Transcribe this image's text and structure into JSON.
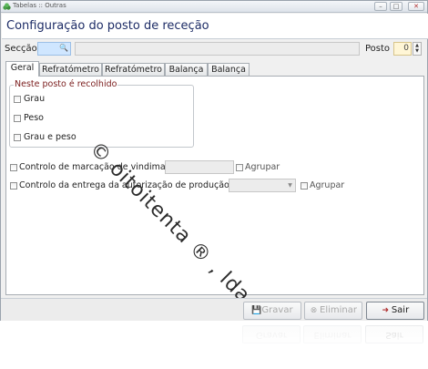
{
  "window": {
    "title": "Tabelas :: Outras",
    "controls": {
      "minimize": "–",
      "maximize": "□",
      "close": "✕"
    }
  },
  "header": {
    "page_title": "Configuração do posto de receção"
  },
  "filters": {
    "seccao_label": "Secção",
    "seccao_value": "",
    "seccao_description": "",
    "posto_label": "Posto",
    "posto_value": "0"
  },
  "tabs": [
    {
      "label": "Geral",
      "active": true
    },
    {
      "label": "Refratómetro 1",
      "active": false
    },
    {
      "label": "Refratómetro 2",
      "active": false
    },
    {
      "label": "Balança 1",
      "active": false
    },
    {
      "label": "Balança 2",
      "active": false
    }
  ],
  "geral": {
    "group_title": "Neste posto é recolhido",
    "options": [
      {
        "label": "Grau",
        "checked": false
      },
      {
        "label": "Peso",
        "checked": false
      },
      {
        "label": "Grau e peso",
        "checked": false
      }
    ],
    "controlo_vindima": {
      "label": "Controlo de marcação de vindima",
      "checked": false,
      "value": "",
      "agrupar_label": "Agrupar",
      "agrupar_checked": false
    },
    "controlo_autorizacao": {
      "label": "Controlo da entrega da autorização de produção",
      "checked": false,
      "value": "",
      "agrupar_label": "Agrupar",
      "agrupar_checked": false
    }
  },
  "watermark": "© oitoitenta ® , lda.",
  "footer": {
    "gravar_label": "Gravar",
    "eliminar_label": "Eliminar",
    "sair_label": "Sair"
  },
  "colors": {
    "title_text": "#1d2c66",
    "group_legend": "#7a1c1c",
    "seccao_field": "#cfe6ff",
    "posto_field": "#fff6d6"
  }
}
